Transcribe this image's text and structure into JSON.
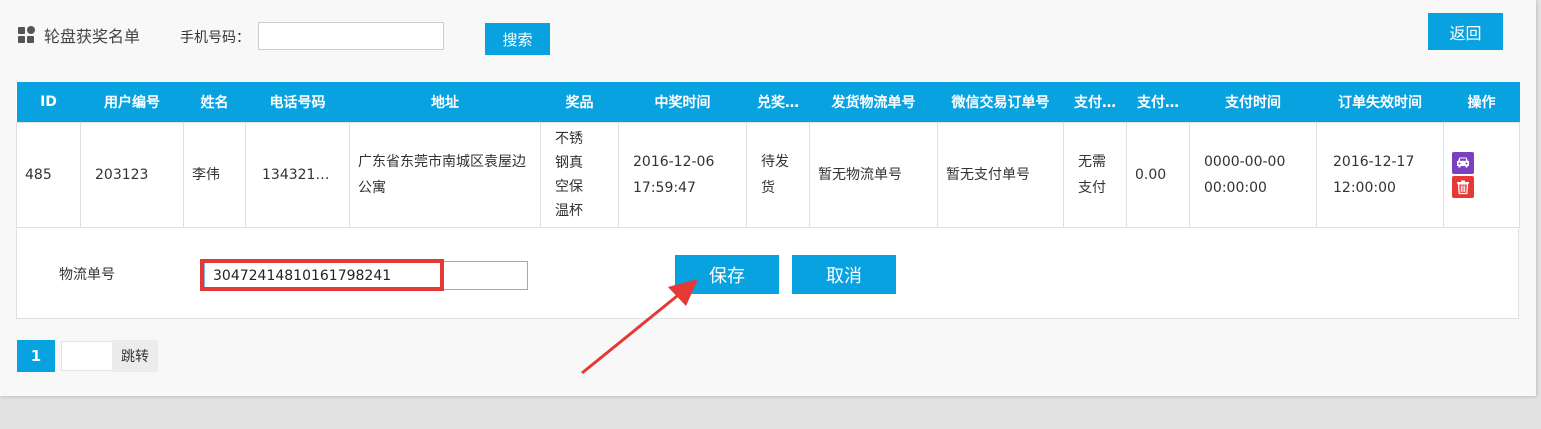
{
  "header": {
    "title": "轮盘获奖名单",
    "phone_label": "手机号码：",
    "phone_value": "",
    "search_label": "搜索",
    "back_label": "返回"
  },
  "table": {
    "columns": [
      "ID",
      "用户编号",
      "姓名",
      "电话号码",
      "地址",
      "奖品",
      "中奖时间",
      "兑奖…",
      "发货物流单号",
      "微信交易订单号",
      "支付…",
      "支付…",
      "支付时间",
      "订单失效时间",
      "操作"
    ],
    "row": {
      "id": "485",
      "user_no": "203123",
      "name": "李伟",
      "phone": "134321…",
      "address": "广东省东莞市南城区袁屋边公寓",
      "prize": "不锈钢真空保温杯",
      "win_time": "2016-12-06 17:59:47",
      "redeem_status": "待发货",
      "logistics_no": "暂无物流单号",
      "wechat_order_no": "暂无支付单号",
      "pay_type": "无需支付",
      "pay_amount": "0.00",
      "pay_time": "0000-00-00 00:00:00",
      "expire_time": "2016-12-17 12:00:00"
    },
    "actions": [
      "car-icon",
      "trash-icon"
    ]
  },
  "edit": {
    "label": "物流单号",
    "value": "30472414810161798241",
    "save_label": "保存",
    "cancel_label": "取消"
  },
  "pager": {
    "current": "1",
    "jump_label": "跳转"
  },
  "colors": {
    "accent": "#09a2e0",
    "highlight": "#e53935",
    "car_icon": "#7b3fbf"
  }
}
